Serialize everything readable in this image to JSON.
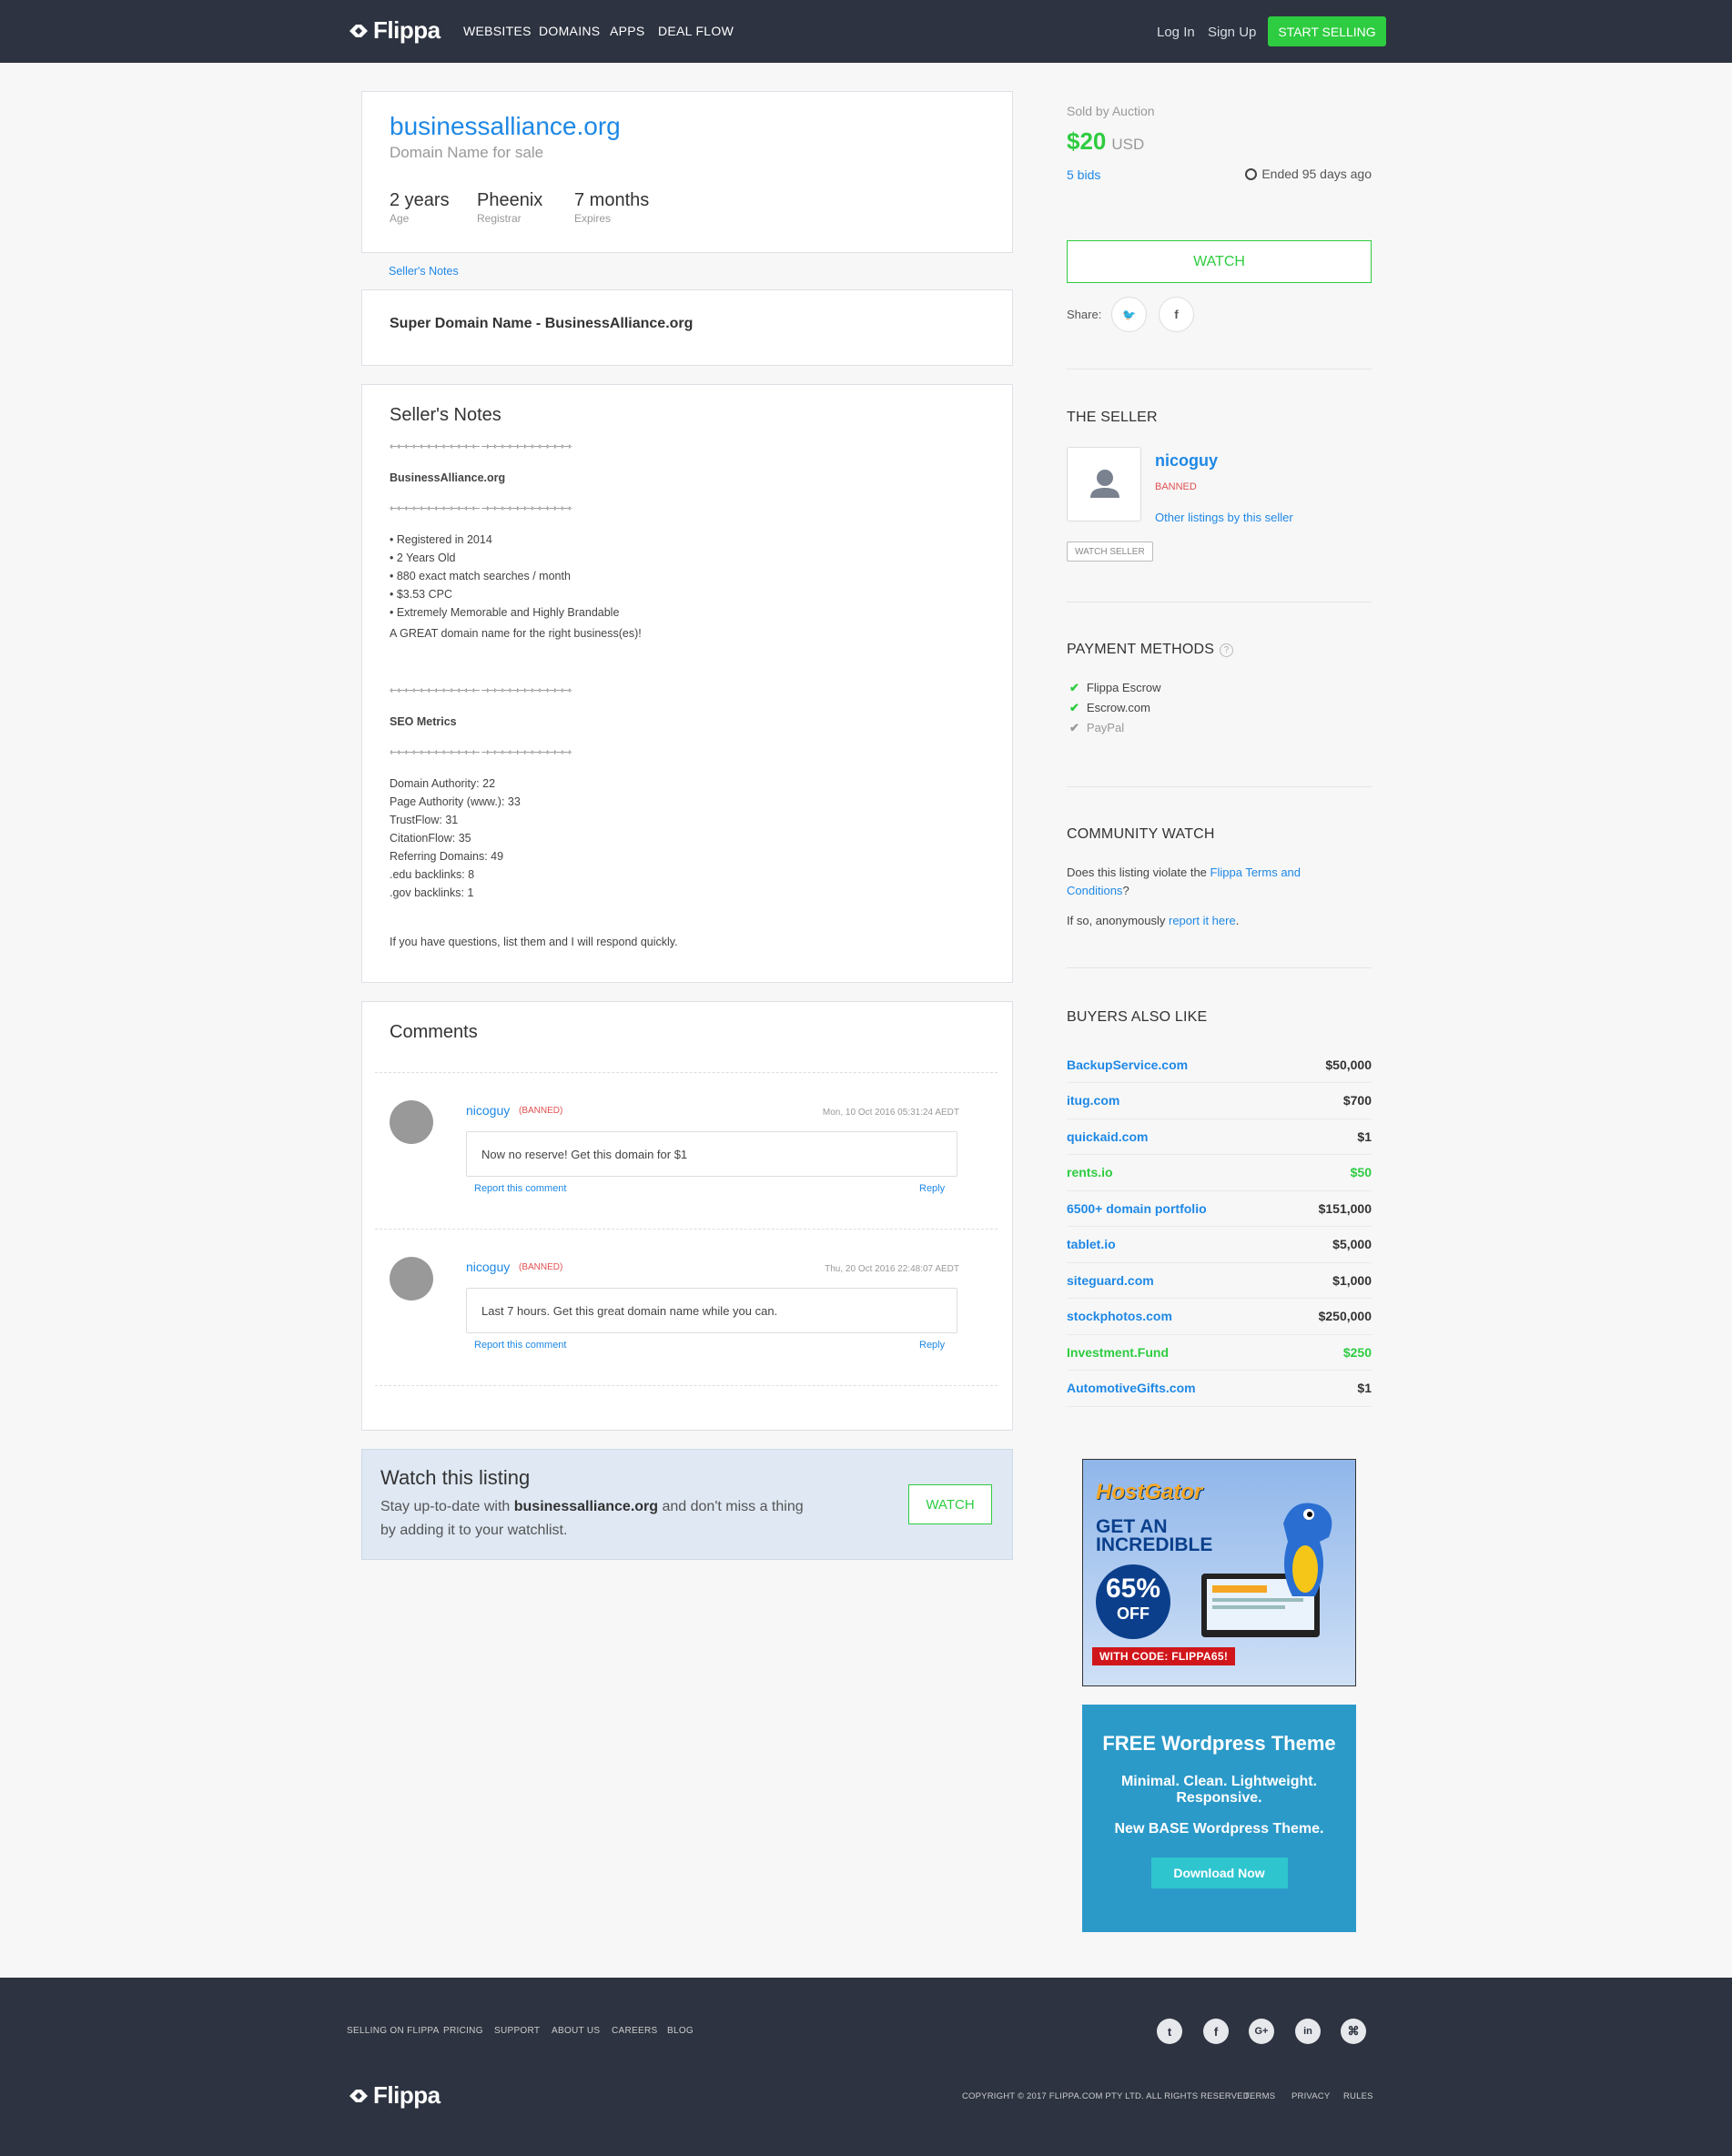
{
  "header": {
    "logo": "Flippa",
    "nav": [
      "WEBSITES",
      "DOMAINS",
      "APPS",
      "DEAL FLOW"
    ],
    "login": "Log In",
    "signup": "Sign Up",
    "sell": "START SELLING"
  },
  "listing": {
    "title": "businessalliance.org",
    "subtitle": "Domain Name for sale",
    "stats": [
      {
        "value": "2 years",
        "label": "Age"
      },
      {
        "value": "Pheenix",
        "label": "Registrar"
      },
      {
        "value": "7 months",
        "label": "Expires"
      }
    ]
  },
  "sellers_notes_link": "Seller's Notes",
  "headline": "Super Domain Name - BusinessAlliance.org",
  "notes": {
    "title": "Seller's Notes",
    "separator": "⇽⇽⇽⇽⇽⇽⇽⇽⇽⇽⇽⇽ ⇾⇾⇾⇾⇾⇾⇾⇾⇾⇾⇾⇾",
    "name": "BusinessAlliance.org",
    "bullets": [
      "• Registered in 2014",
      "• 2 Years Old",
      "• 880 exact match searches / month",
      "• $3.53 CPC",
      "• Extremely Memorable and Highly Brandable"
    ],
    "pitch": "A GREAT domain name for the right business(es)!",
    "seo_title": "SEO Metrics",
    "seo": [
      "Domain Authority: 22",
      "Page Authority (www.): 33",
      "TrustFlow: 31",
      "CitationFlow: 35",
      "Referring Domains: 49",
      ".edu backlinks: 8",
      ".gov backlinks: 1"
    ],
    "closing": "If you have questions, list them and I will respond quickly."
  },
  "comments": {
    "title": "Comments",
    "items": [
      {
        "user": "nicoguy",
        "badge": "BANNED",
        "date": "Mon, 10 Oct 2016 05:31:24 AEDT",
        "text": "Now no reserve! Get this domain for $1",
        "report": "Report this comment",
        "reply": "Reply"
      },
      {
        "user": "nicoguy",
        "badge": "BANNED",
        "date": "Thu, 20 Oct 2016 22:48:07 AEDT",
        "text": "Last 7 hours. Get this great domain name while you can.",
        "report": "Report this comment",
        "reply": "Reply"
      }
    ]
  },
  "watch_box": {
    "title": "Watch this listing",
    "text_pre": "Stay up-to-date with ",
    "domain": "businessalliance.org",
    "text_post": " and don't miss a thing by adding it to your watchlist.",
    "button": "WATCH"
  },
  "sidebar": {
    "sold_by": "Sold by Auction",
    "price": "$20",
    "currency": "USD",
    "bids": "5 bids",
    "ended": "Ended 95 days ago",
    "watch": "WATCH",
    "share": "Share:",
    "seller": {
      "title": "THE SELLER",
      "name": "nicoguy",
      "status": "BANNED",
      "other": "Other listings by this seller",
      "watch": "WATCH SELLER"
    },
    "payment": {
      "title": "PAYMENT METHODS",
      "methods": [
        "Flippa Escrow",
        "Escrow.com",
        "PayPal"
      ]
    },
    "community": {
      "title": "COMMUNITY WATCH",
      "q_pre": "Does this listing violate the ",
      "q_link": "Flippa Terms and Conditions",
      "q_post": "?",
      "a_pre": "If so, anonymously ",
      "a_link": "report it here",
      "a_post": "."
    },
    "buyers": {
      "title": "BUYERS ALSO LIKE",
      "items": [
        {
          "name": "BackupService.com",
          "price": "$50,000",
          "green": false
        },
        {
          "name": "itug.com",
          "price": "$700",
          "green": false
        },
        {
          "name": "quickaid.com",
          "price": "$1",
          "green": false
        },
        {
          "name": "rents.io",
          "price": "$50",
          "green": true
        },
        {
          "name": "6500+ domain portfolio",
          "price": "$151,000",
          "green": false
        },
        {
          "name": "tablet.io",
          "price": "$5,000",
          "green": false
        },
        {
          "name": "siteguard.com",
          "price": "$1,000",
          "green": false
        },
        {
          "name": "stockphotos.com",
          "price": "$250,000",
          "green": false
        },
        {
          "name": "Investment.Fund",
          "price": "$250",
          "green": true
        },
        {
          "name": "AutomotiveGifts.com",
          "price": "$1",
          "green": false
        }
      ]
    },
    "ad1": {
      "brand": "HostGator",
      "line1": "GET AN",
      "line2": "INCREDIBLE",
      "pct": "65%",
      "off": "OFF",
      "code": "WITH CODE: FLIPPA65!"
    },
    "ad2": {
      "title": "FREE Wordpress Theme",
      "l1": "Minimal. Clean. Lightweight.",
      "l2": "Responsive.",
      "l3": "New BASE Wordpress Theme.",
      "btn": "Download Now"
    }
  },
  "footer": {
    "links": [
      "SELLING ON FLIPPA",
      "PRICING",
      "SUPPORT",
      "ABOUT US",
      "CAREERS",
      "BLOG"
    ],
    "logo": "Flippa",
    "copyright": "COPYRIGHT © 2017 FLIPPA.COM PTY LTD. ALL RIGHTS RESERVED.",
    "legal": [
      "TERMS",
      "PRIVACY",
      "RULES"
    ],
    "social": [
      "twitter-icon",
      "facebook-icon",
      "google-plus-icon",
      "linkedin-icon",
      "github-icon"
    ]
  },
  "colors": {
    "header": "#2d3340",
    "accent": "#1e88e5",
    "green": "#2ecc40",
    "banned": "#e05050"
  }
}
